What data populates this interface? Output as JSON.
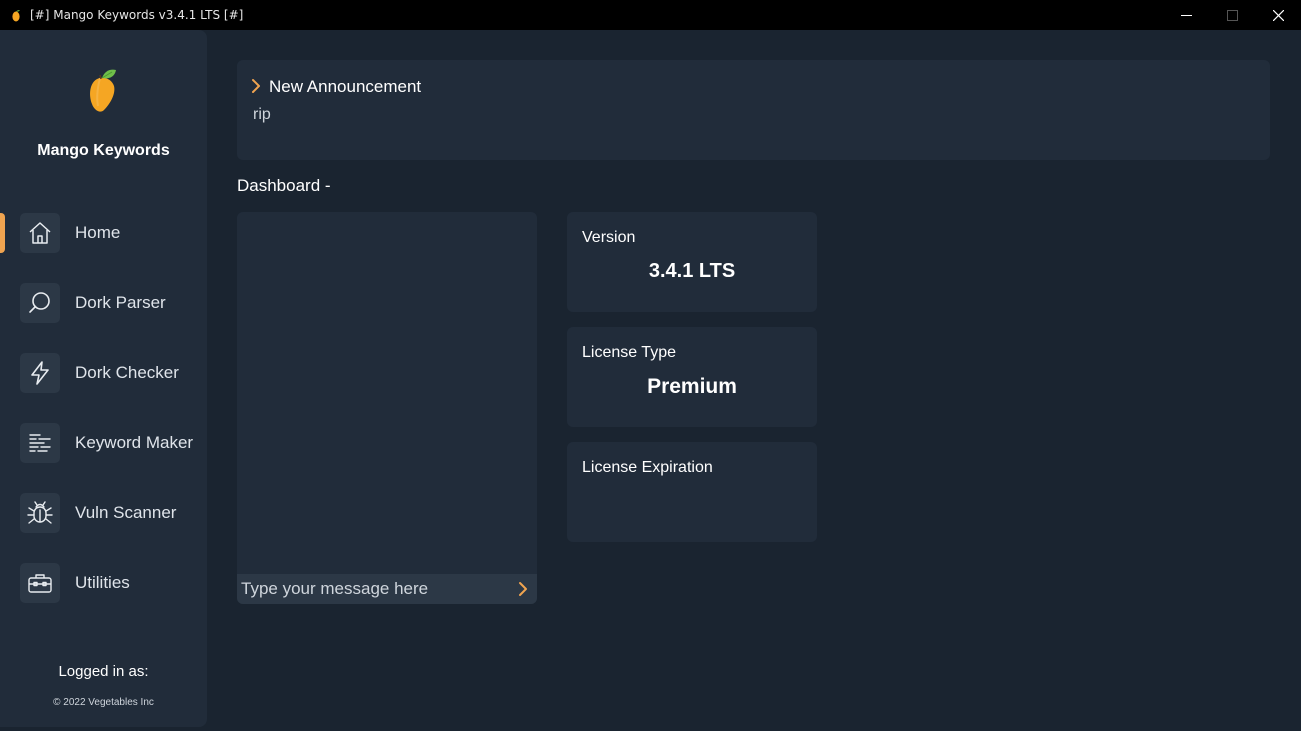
{
  "window": {
    "title": "[#] Mango Keywords v3.4.1 LTS [#]"
  },
  "sidebar": {
    "brand": "Mango Keywords",
    "items": [
      {
        "label": "Home",
        "icon": "home-icon",
        "active": true
      },
      {
        "label": "Dork Parser",
        "icon": "search-icon"
      },
      {
        "label": "Dork Checker",
        "icon": "lightning-icon"
      },
      {
        "label": "Keyword Maker",
        "icon": "list-icon"
      },
      {
        "label": "Vuln Scanner",
        "icon": "bug-icon"
      },
      {
        "label": "Utilities",
        "icon": "toolbox-icon"
      }
    ],
    "logged_in_label": "Logged in as:",
    "copyright": "© 2022 Vegetables Inc"
  },
  "announcement": {
    "title": "New Announcement",
    "body": "rip"
  },
  "dashboard": {
    "title": "Dashboard -",
    "chat": {
      "placeholder": "Type your message here"
    },
    "cards": [
      {
        "label": "Version",
        "value": "3.4.1 LTS"
      },
      {
        "label": "License Type",
        "value": "Premium"
      },
      {
        "label": "License Expiration",
        "value": ""
      }
    ]
  },
  "colors": {
    "background": "#1a2430",
    "panel": "#212c3a",
    "accent": "#f0a450",
    "icon_bg": "#2c3846"
  }
}
